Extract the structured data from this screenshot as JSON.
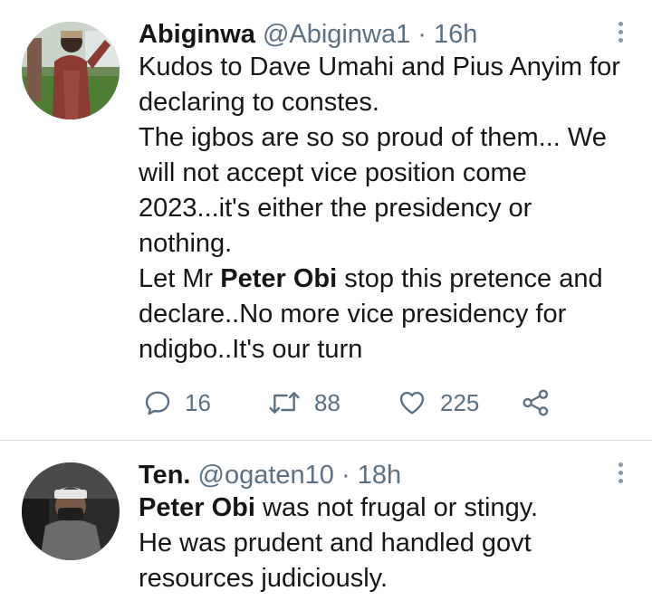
{
  "tweets": [
    {
      "display_name": "Abiginwa",
      "handle": "@Abiginwa1",
      "separator": "·",
      "time": "16h",
      "lines": [
        "Kudos to Dave Umahi and Pius Anyim for",
        "declaring to constes.",
        "The igbos are so so proud of them... We",
        "will not accept vice position come",
        "2023...it's either the presidency or",
        "nothing.",
        {
          "pre": "Let Mr ",
          "bold": "Peter Obi",
          "post": " stop this pretence and"
        },
        "declare..No more vice presidency for",
        "ndigbo..It's our turn"
      ],
      "replies": "16",
      "retweets": "88",
      "likes": "225"
    },
    {
      "display_name": "Ten.",
      "handle": "@ogaten10",
      "separator": "·",
      "time": "18h",
      "lines": [
        {
          "pre": "",
          "bold": "Peter Obi",
          "post": " was not frugal or stingy."
        },
        "He was prudent and handled govt",
        "resources judiciously."
      ]
    }
  ],
  "icons": {
    "more": "more-vertical-icon",
    "reply": "reply-icon",
    "retweet": "retweet-icon",
    "like": "heart-icon",
    "share": "share-icon"
  },
  "colors": {
    "text": "#14171a",
    "secondary": "#5b7083",
    "divider": "#d9dde0"
  }
}
